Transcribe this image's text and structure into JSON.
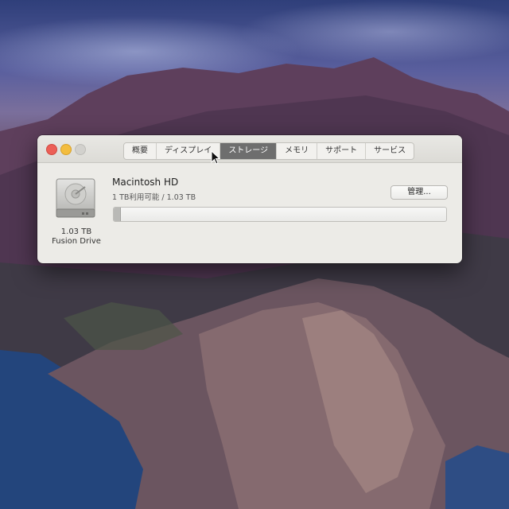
{
  "window": {
    "tabs": [
      {
        "label": "概要",
        "active": false
      },
      {
        "label": "ディスプレイ",
        "active": false
      },
      {
        "label": "ストレージ",
        "active": true
      },
      {
        "label": "メモリ",
        "active": false
      },
      {
        "label": "サポート",
        "active": false
      },
      {
        "label": "サービス",
        "active": false
      }
    ]
  },
  "disk": {
    "name": "Macintosh HD",
    "availability": "1 TB利用可能 / 1.03 TB",
    "size": "1.03 TB",
    "type": "Fusion Drive",
    "manage_label": "管理...",
    "used_fraction": 0.02
  },
  "icons": {
    "disk": "internal-hard-drive-icon",
    "cursor": "mouse-pointer-icon"
  },
  "colors": {
    "close": "#ec5f57",
    "minimize": "#f3bd3f",
    "active_tab": "#6e6e6e"
  }
}
